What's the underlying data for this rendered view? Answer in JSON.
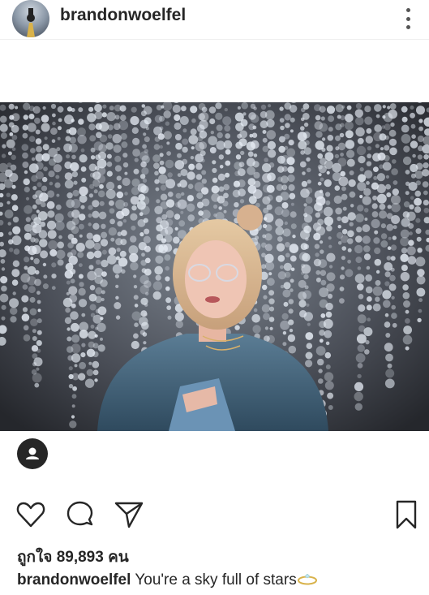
{
  "post": {
    "username": "brandonwoelfel",
    "likes_text": "ถูกใจ 89,893 คน",
    "caption_user": "brandonwoelfel",
    "caption_text": "You're a sky full of stars",
    "caption_emoji_icon": "ring-icon"
  },
  "icons": {
    "more": "more-options-icon",
    "user_tag": "user-tag-icon",
    "like": "heart-icon",
    "comment": "comment-icon",
    "share": "send-icon",
    "save": "bookmark-icon"
  },
  "colors": {
    "text": "#262626",
    "background": "#ffffff",
    "divider": "#efefef"
  }
}
